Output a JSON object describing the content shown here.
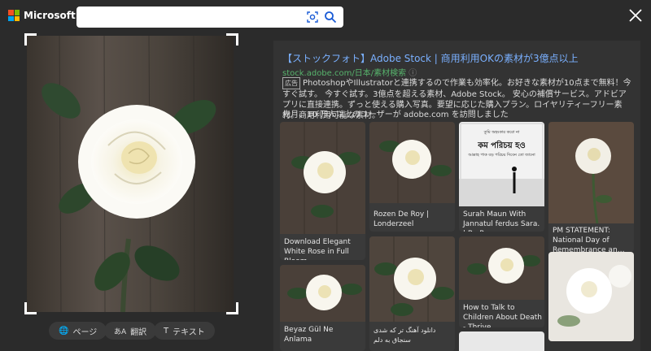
{
  "brand": {
    "name": "Microsoft Bing"
  },
  "search": {
    "value": "",
    "placeholder": ""
  },
  "toolbar": {
    "page_label": "ページ",
    "translate_label": "翻訳",
    "text_label": "テキスト"
  },
  "result": {
    "title": "【ストックフォト】Adobe Stock | 商用利用OKの素材が3億点以上",
    "url": "stock.adobe.com/日本/素材検索",
    "ad_badge": "広告",
    "description": "PhotoshopやIllustratorと連携するので作業も効率化。お好きな素材が10点まで無料！今すぐ試す。 今すぐ試す。3億点を超える素材、Adobe Stock。 安心の補償サービス。アドビアプリに直接連携。ずっと使える購入写真。要望に応じた購入プラン。ロイヤリティーフリー素材。商用利用可能な素材。",
    "visit": "先月、10 万人以上のユーザーが adobe.com を訪問しました"
  },
  "cards": [
    {
      "caption": "Download Elegant White Rose in Full Bloom…"
    },
    {
      "caption": "Rozen De Roy | Londerzeel"
    },
    {
      "caption": "Surah Maun With Jannatul ferdus Sara. | By Peace …"
    },
    {
      "caption": "PM STATEMENT: National Day of Remembrance an…"
    },
    {
      "caption": "Beyaz Gül Ne Anlama"
    },
    {
      "caption": "دانلود آهنگ تر که شدی سنجاق به دلم"
    },
    {
      "caption": "How to Talk to Children About Death - Thrive…"
    },
    {
      "caption": ""
    }
  ],
  "poster": {
    "line1": "তুমি অহংকার করো না",
    "line2": "কম পরিচয় হও",
    "line3": "আল্লাহ পাক বড় পরিচয় দিবেন তো জানো"
  },
  "colors": {
    "accent": "#1a5bd6",
    "link": "#7ab0ff",
    "url": "#57b36c"
  }
}
